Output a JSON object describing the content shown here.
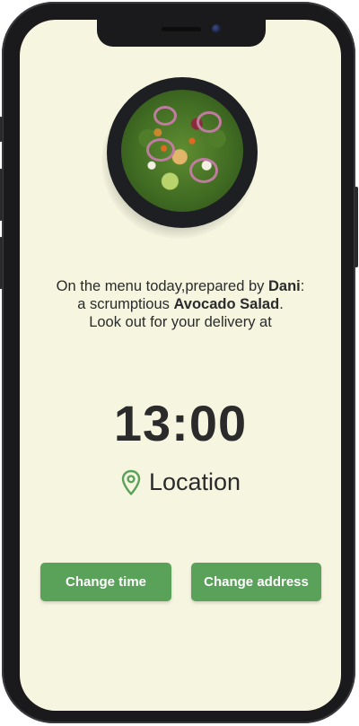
{
  "colors": {
    "screen_background": "#f5f5e0",
    "accent": "#5aa15a",
    "text": "#2b2b2b",
    "location_icon": "#5aa15a"
  },
  "meal_image": {
    "icon": "salad-plate-image"
  },
  "message": {
    "line1_prefix": "On the menu today,prepared by ",
    "chef_name": "Dani",
    "line1_suffix": ":",
    "line2_prefix": "a scrumptious ",
    "dish_name": "Avocado Salad",
    "line2_suffix": ".",
    "line3": "Look out for your delivery at"
  },
  "delivery_time": "13:00",
  "location": {
    "icon": "map-pin-icon",
    "label": "Location"
  },
  "buttons": {
    "change_time": "Change time",
    "change_address": "Change address"
  }
}
